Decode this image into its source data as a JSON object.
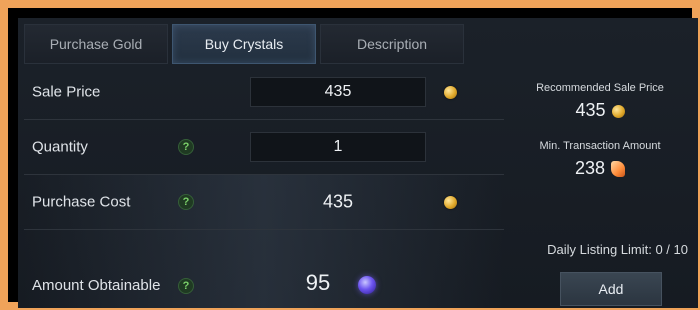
{
  "tabs": [
    {
      "label": "Purchase Gold",
      "active": false
    },
    {
      "label": "Buy Crystals",
      "active": true
    },
    {
      "label": "Description",
      "active": false
    }
  ],
  "form": {
    "sale_price": {
      "label": "Sale Price",
      "value": "435",
      "currency_icon": "gold-coin-icon"
    },
    "quantity": {
      "label": "Quantity",
      "value": "1",
      "help": "?"
    },
    "purchase_cost": {
      "label": "Purchase Cost",
      "value": "435",
      "help": "?",
      "currency_icon": "gold-coin-icon"
    },
    "amount_obtainable": {
      "label": "Amount Obtainable",
      "value": "95",
      "help": "?",
      "currency_icon": "crystal-icon"
    }
  },
  "info": {
    "recommended_label": "Recommended Sale Price",
    "recommended_value": "435",
    "min_transaction_label": "Min. Transaction Amount",
    "min_transaction_value": "238"
  },
  "daily_limit": "Daily Listing Limit: 0 / 10",
  "add_button": "Add",
  "colors": {
    "frame": "#f0a35a",
    "panel": "#1b2129",
    "active_tab": "#2c3a4c",
    "help_green": "#7bd06a"
  }
}
